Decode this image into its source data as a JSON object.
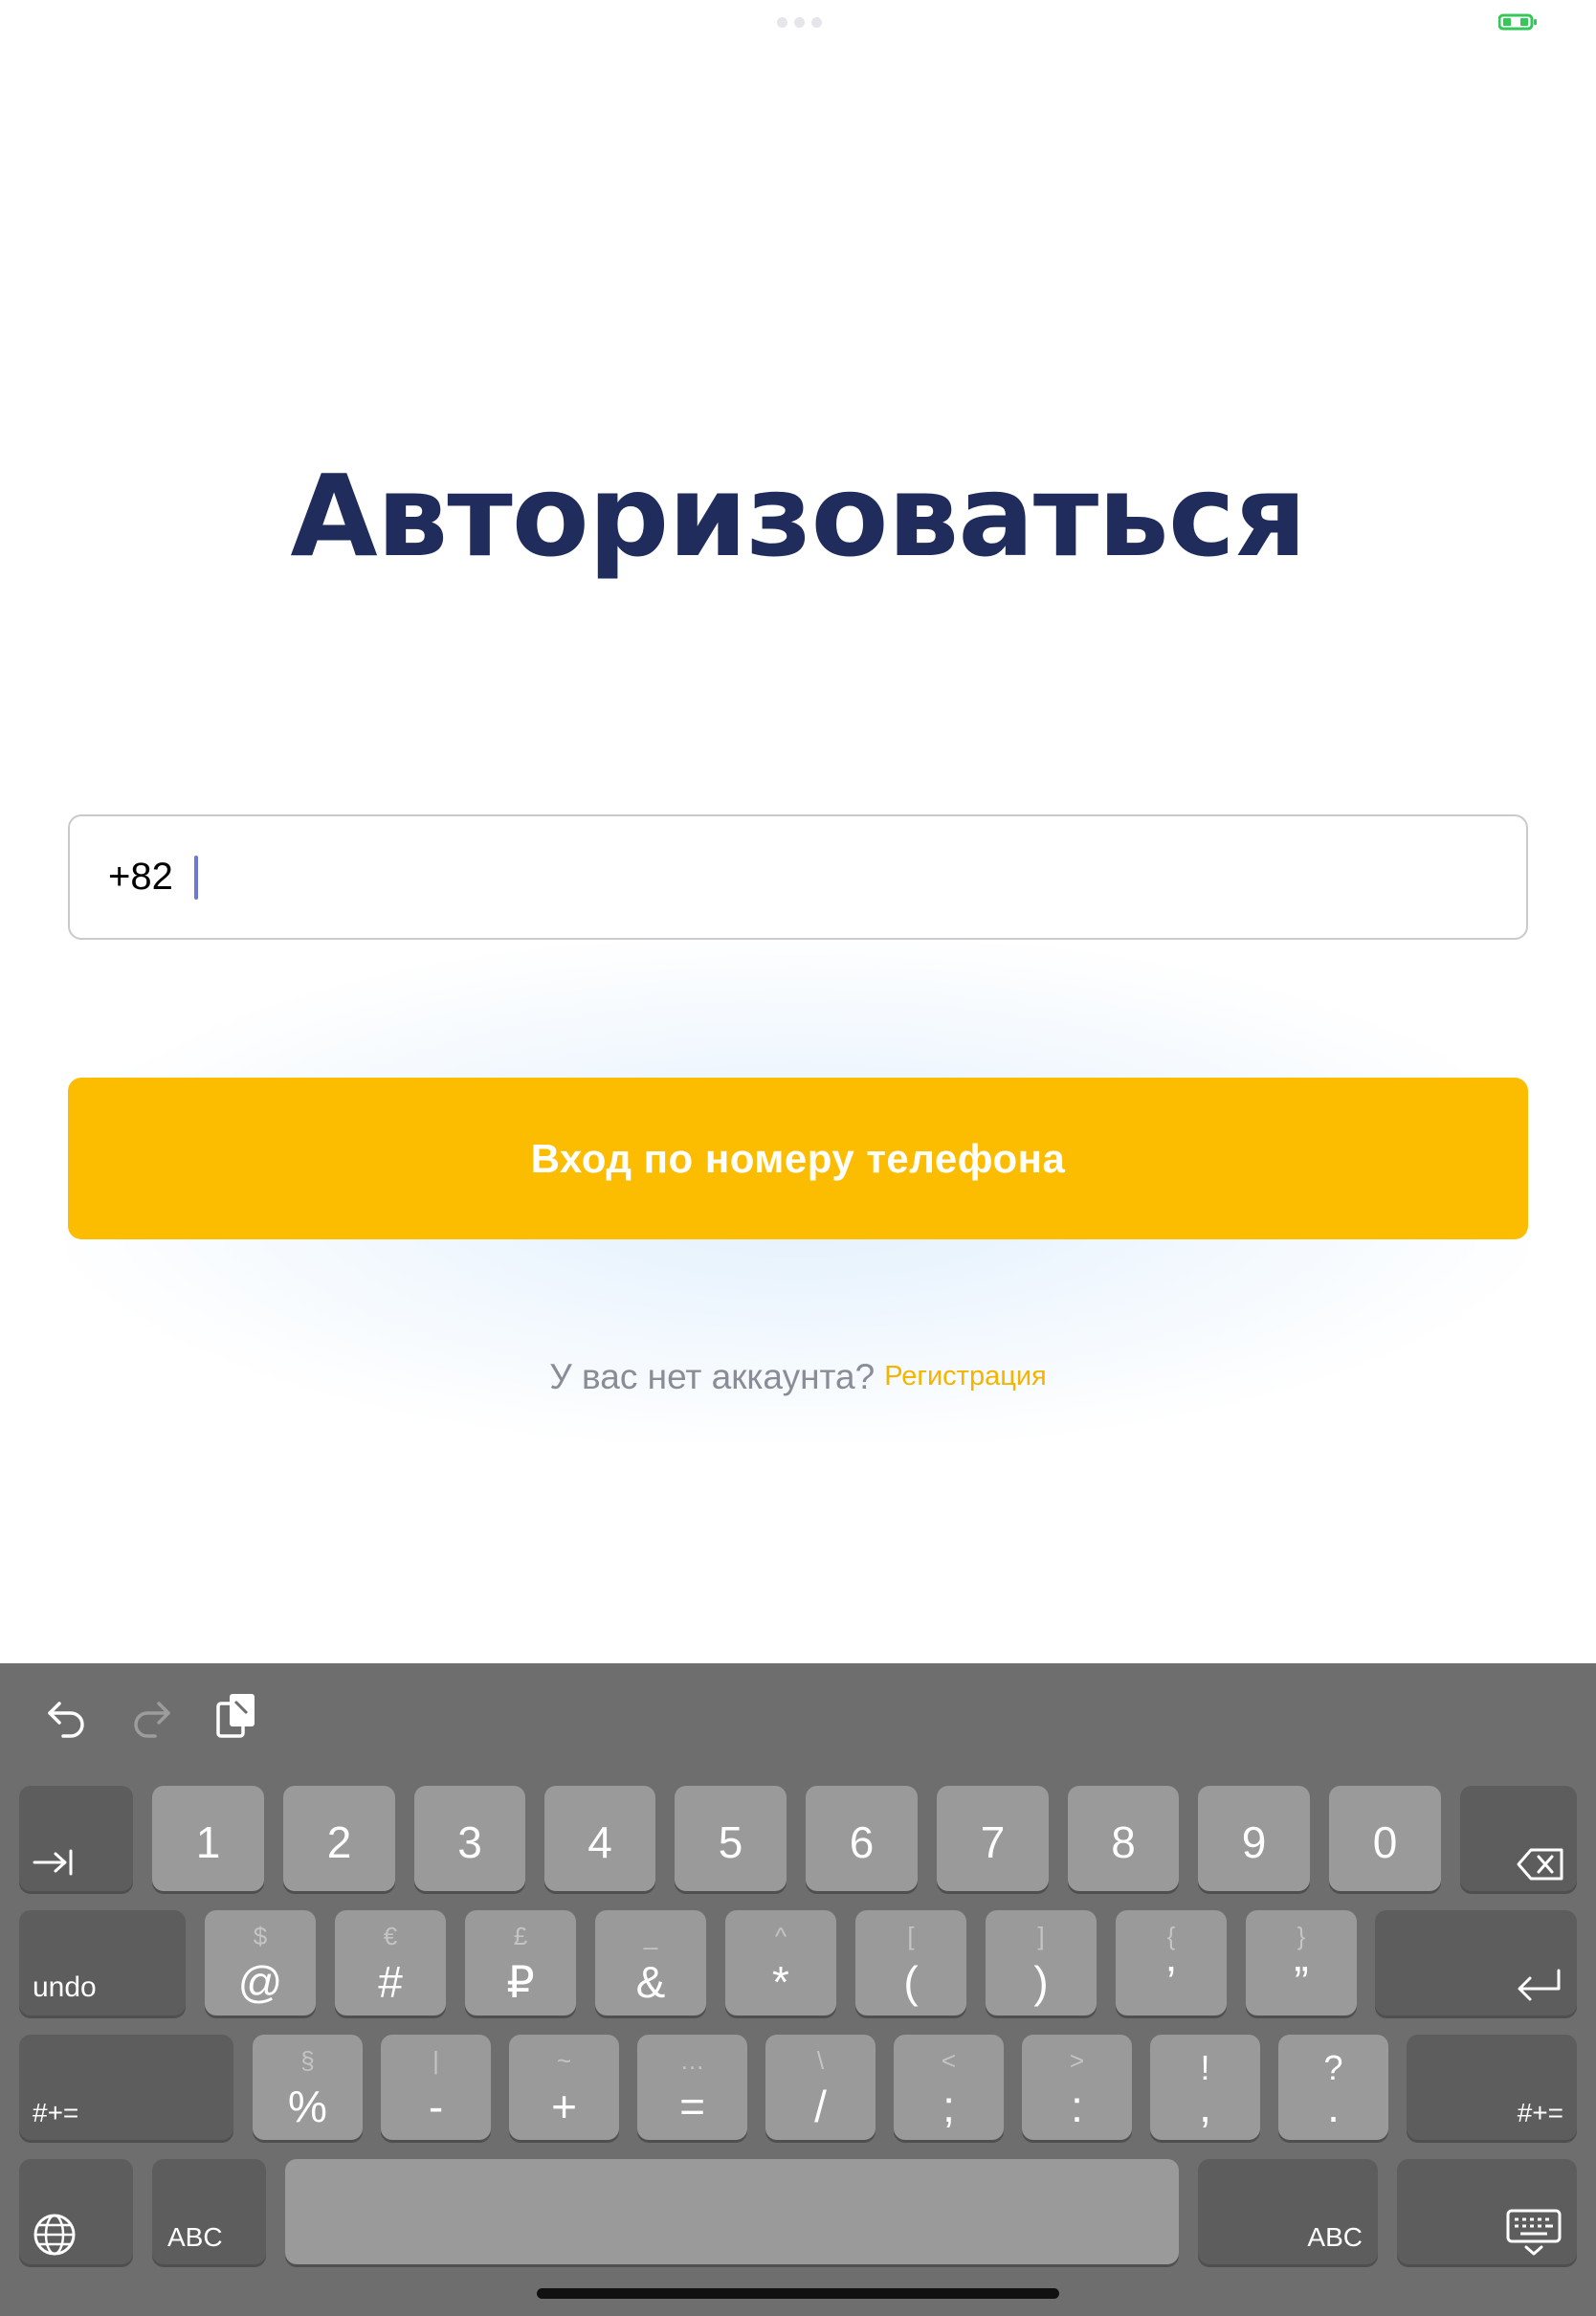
{
  "title": "Авторизоваться",
  "phone_input": {
    "value": "+82"
  },
  "login_button": {
    "label": "Вход по номеру телефона"
  },
  "register": {
    "prompt": "У вас нет аккаунта?",
    "link": "Регистрация"
  },
  "colors": {
    "title": "#1f2c5c",
    "accent": "#fcbd00",
    "link": "#f4b400",
    "caret": "#6b78d8",
    "battery": "#34c759"
  },
  "keyboard": {
    "toolbar": [
      "undo-icon",
      "redo-icon",
      "clipboard-icon"
    ],
    "row1": {
      "left": "tab-icon",
      "keys": [
        "1",
        "2",
        "3",
        "4",
        "5",
        "6",
        "7",
        "8",
        "9",
        "0"
      ],
      "right": "backspace-icon"
    },
    "row2": {
      "left": "undo",
      "keys": [
        {
          "main": "@",
          "alt": "$"
        },
        {
          "main": "#",
          "alt": "€"
        },
        {
          "main": "₽",
          "alt": "£"
        },
        {
          "main": "&",
          "alt": "_"
        },
        {
          "main": "*",
          "alt": "^"
        },
        {
          "main": "(",
          "alt": "["
        },
        {
          "main": ")",
          "alt": "]"
        },
        {
          "main": "’",
          "alt": "{"
        },
        {
          "main": "”",
          "alt": "}"
        }
      ],
      "right": "return-icon"
    },
    "row3": {
      "left": "#+=",
      "keys": [
        {
          "main": "%",
          "alt": "§"
        },
        {
          "main": "-",
          "alt": "|"
        },
        {
          "main": "+",
          "alt": "~"
        },
        {
          "main": "=",
          "alt": "…"
        },
        {
          "main": "/",
          "alt": "\\"
        },
        {
          "main": ";",
          "alt": "<"
        },
        {
          "main": ":",
          "alt": ">"
        },
        {
          "main": ",",
          "alt": "!"
        },
        {
          "main": ".",
          "alt": "?"
        }
      ],
      "right": "#+="
    },
    "row4": {
      "globe": "globe-icon",
      "left_abc": "ABC",
      "space": "",
      "right_abc": "ABC",
      "hide": "keyboard-hide-icon"
    }
  }
}
